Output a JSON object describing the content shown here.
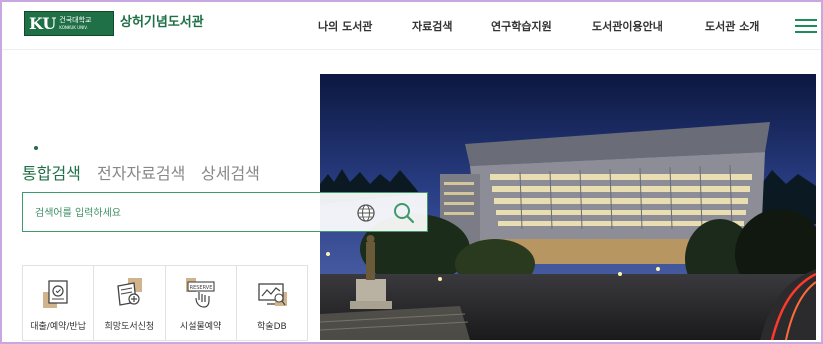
{
  "header": {
    "logo_text": "KU",
    "logo_korean": "건국대학교",
    "logo_english": "KONKUK UNIV.",
    "site_title": "상허기념도서관",
    "nav": [
      "나의 도서관",
      "자료검색",
      "연구학습지원",
      "도서관이용안내",
      "도서관 소개"
    ],
    "menu_icon": "hamburger-menu-icon"
  },
  "search_tabs": {
    "items": [
      "통합검색",
      "전자자료검색",
      "상세검색"
    ],
    "active": "통합검색"
  },
  "search": {
    "placeholder": "검색어를 입력하세요",
    "value": "",
    "icons": [
      "globe-icon",
      "search-icon"
    ]
  },
  "quick_links": [
    {
      "label": "대출/예약/반납",
      "icon": "book-circle-icon"
    },
    {
      "label": "희망도서신청",
      "icon": "book-plus-icon"
    },
    {
      "label": "시설물예약",
      "icon": "reserve-hand-icon",
      "icon_text": "RESERVE"
    },
    {
      "label": "학술DB",
      "icon": "monitor-chart-icon"
    }
  ],
  "colors": {
    "brand_green": "#1f6f47",
    "accent_green": "#3e9a6c",
    "tan": "#d2b48c",
    "frame": "#c9a7e0"
  },
  "hero": {
    "image": "library-building-night-photo"
  }
}
